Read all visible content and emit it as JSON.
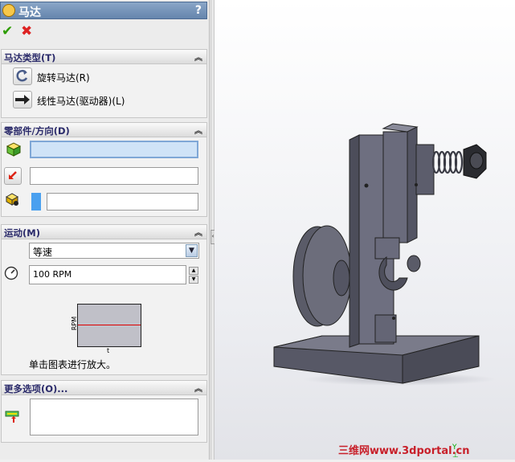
{
  "header": {
    "title": "马达",
    "help": "?"
  },
  "actions": {
    "ok": "✔",
    "cancel": "✖"
  },
  "motor_type": {
    "heading": "马达类型(T)",
    "options": [
      {
        "label": "旋转马达(R)",
        "icon": "rotary-motor-icon",
        "selected": true
      },
      {
        "label": "线性马达(驱动器)(L)",
        "icon": "linear-motor-icon",
        "selected": false
      }
    ]
  },
  "component_direction": {
    "heading": "零部件/方向(D)",
    "fields": [
      {
        "icon": "component-cube-icon",
        "value": ""
      },
      {
        "icon": "direction-arrow-icon",
        "value": ""
      },
      {
        "icon": "relative-component-icon",
        "value": ""
      }
    ]
  },
  "motion": {
    "heading": "运动(M)",
    "type_value": "等速",
    "speed_value": "100 RPM",
    "graph": {
      "ylabel": "RPM",
      "xlabel": "t"
    },
    "hint": "单击图表进行放大。"
  },
  "more_options": {
    "heading": "更多选项(O)..."
  },
  "watermark": "三维网www.3dportal.cn",
  "colors": {
    "title_bar": "#6f8db5",
    "section_header": "#2a2a6a",
    "selected_field": "#cfe3f7",
    "model": "#6e6f80",
    "watermark": "#c8202a"
  }
}
